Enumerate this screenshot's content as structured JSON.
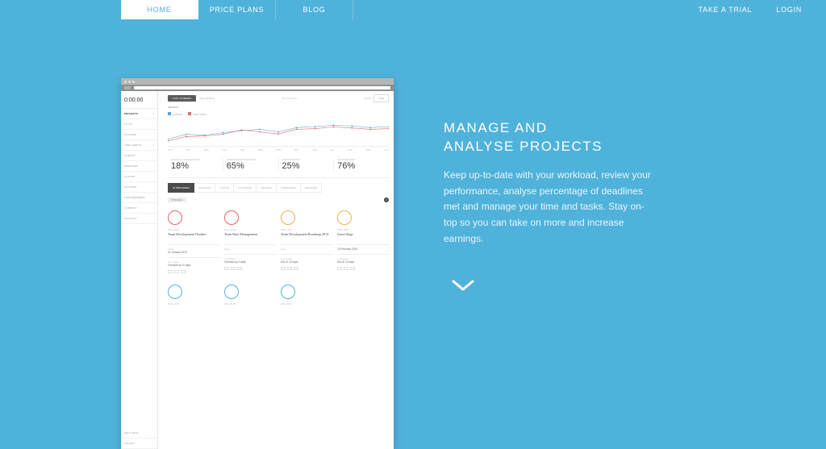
{
  "nav": {
    "left": [
      "HOME",
      "PRICE PLANS",
      "BLOG"
    ],
    "right": [
      "TAKE A TRIAL",
      "LOGIN"
    ]
  },
  "copy": {
    "heading_l1": "MANAGE AND",
    "heading_l2": " ANALYSE PROJECTS",
    "body": "Keep up-to-date with your workload, review your performance, analyse percentage of deadlines met and manage your time and tasks. Stay on-top so you can take on more and increase earnings."
  },
  "dashboard": {
    "timer": "0:00:00",
    "sidebar": [
      {
        "label": "PROJECTS",
        "active": true
      },
      {
        "label": "TO DO"
      },
      {
        "label": "PLANNER"
      },
      {
        "label": "TIME SHEETS"
      },
      {
        "label": "CLIENTS"
      },
      {
        "label": "EXPENSES"
      },
      {
        "label": "QUOTES"
      },
      {
        "label": "INVOICES"
      },
      {
        "label": "TEAM MEMBERS"
      },
      {
        "label": "COMPANY"
      },
      {
        "label": "ACCOUNT"
      }
    ],
    "lower_sidebar": [
      {
        "label": "HELP DESK"
      },
      {
        "label": "LOGOUT"
      }
    ],
    "filters": {
      "active": "LAST 12 WEEKS",
      "alt": "THIS MONTH",
      "clients": "ALL CLIENTS",
      "team": "TEAM",
      "you": "YOU"
    },
    "metrics_label": "METRICS",
    "legend": {
      "a": "BUDGET",
      "b": "TIME SPENT"
    },
    "xaxis": [
      "OCT",
      "NOV",
      "DEC",
      "JAN",
      "FEB",
      "MAR",
      "APR",
      "MAY",
      "JUN",
      "JUL",
      "AUG",
      "SEP",
      "OCT"
    ],
    "stats": [
      {
        "label": "PROJECTS OVER BUDGET",
        "value": "18%"
      },
      {
        "label": "AVERAGE PROFIT MARGIN",
        "value": "65%"
      },
      {
        "label": "PROFIT MARGIN",
        "value": "25%"
      },
      {
        "label": "DEADLINES MET",
        "value": "76%"
      }
    ],
    "tabs": [
      "IN PROGRESS",
      "ON-GOING",
      "A PITCH",
      "TO INVOICE",
      "ON HOLD",
      "COMPLETED",
      "ARCHIVED"
    ],
    "tag": "INTERNAL",
    "count": "4",
    "cards": [
      {
        "ring": "red",
        "tiny": "DUE: 24/01",
        "title": "Team Development October",
        "type": "Fixed",
        "date": "24 January 2015",
        "status": "In progress",
        "overdue": "Overdue by 10 days"
      },
      {
        "ring": "red",
        "tiny": "DUE: 11/02",
        "title": "Team Rota Management",
        "type": "Fixed",
        "date": "",
        "status": "In progress",
        "overdue": "Overdue by 2 days"
      },
      {
        "ring": "orange",
        "tiny": "DUE: 13/02",
        "title": "Team Development Roadmap 2014",
        "type": "Retro",
        "date": "",
        "status": "In progress",
        "overdue": "Due in 10 days"
      },
      {
        "ring": "orange",
        "tiny": "DUE: 13/02",
        "title": "Guest blogs",
        "type": "",
        "date": "13 February 2015",
        "status": "In progress",
        "overdue": "Due in 22 days"
      }
    ],
    "cards2": [
      {
        "ring": "blue",
        "tiny": "DUE: 21/03"
      },
      {
        "ring": "blue",
        "tiny": "DUE: 21/03"
      },
      {
        "ring": "blue",
        "tiny": "DUE: 21/03"
      }
    ]
  },
  "chart_data": {
    "type": "line",
    "x": [
      "OCT",
      "NOV",
      "DEC",
      "JAN",
      "FEB",
      "MAR",
      "APR",
      "MAY",
      "JUN",
      "JUL",
      "AUG",
      "SEP",
      "OCT"
    ],
    "series": [
      {
        "name": "BUDGET",
        "color": "#5aa7d6",
        "values": [
          20,
          35,
          32,
          40,
          46,
          50,
          42,
          55,
          58,
          62,
          60,
          55,
          58
        ]
      },
      {
        "name": "TIME SPENT",
        "color": "#e06c6c",
        "values": [
          15,
          28,
          30,
          35,
          48,
          42,
          36,
          50,
          52,
          57,
          54,
          50,
          52
        ]
      }
    ],
    "ylim": [
      0,
      80
    ],
    "xlabel": "",
    "ylabel": ""
  }
}
